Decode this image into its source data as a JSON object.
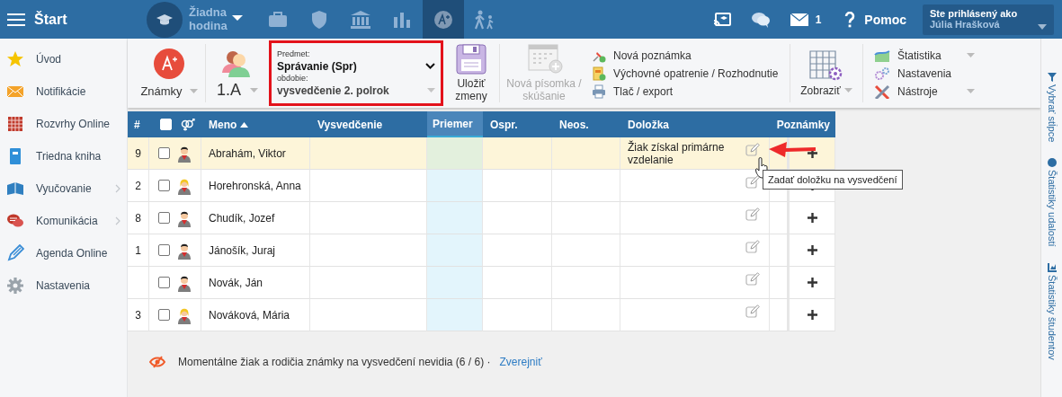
{
  "topbar": {
    "menu_label": "Štart",
    "lesson": "Žiadna hodina",
    "nav": [
      {
        "kind": "briefcase",
        "selected": false
      },
      {
        "kind": "shield",
        "selected": false
      },
      {
        "kind": "bank",
        "selected": false
      },
      {
        "kind": "chart",
        "selected": false
      },
      {
        "kind": "grade",
        "selected": true
      },
      {
        "kind": "walk",
        "selected": false
      }
    ],
    "message_count": "1",
    "help": "Pomoc",
    "user": {
      "caption": "Ste prihlásený ako",
      "name": "Júlia Hrašková"
    }
  },
  "sidebar": {
    "items": [
      {
        "label": "Úvod",
        "kind": "star",
        "has_submenu": false
      },
      {
        "label": "Notifikácie",
        "kind": "mail",
        "has_submenu": false
      },
      {
        "label": "Rozvrhy Online",
        "kind": "calendar",
        "has_submenu": false
      },
      {
        "label": "Triedna kniha",
        "kind": "book",
        "has_submenu": false
      },
      {
        "label": "Vyučovanie",
        "kind": "openbook",
        "has_submenu": true
      },
      {
        "label": "Komunikácia",
        "kind": "chat",
        "has_submenu": true
      },
      {
        "label": "Agenda Online",
        "kind": "pen",
        "has_submenu": false
      },
      {
        "label": "Nastavenia",
        "kind": "gear",
        "has_submenu": false
      }
    ]
  },
  "toolbar": {
    "grades": "Známky",
    "class": "1.A",
    "subject": {
      "label": "Predmet:",
      "value": "Správanie (Spr)"
    },
    "period": {
      "label": "obdobie:",
      "value": "vysvedčenie 2. polrok"
    },
    "save": "Uložiť zmeny",
    "new_test": {
      "label": "Nová písomka / skúšanie",
      "disabled": true
    },
    "actions": [
      {
        "label": "Nová poznámka",
        "kind": "pin"
      },
      {
        "label": "Výchovné opatrenie / Rozhodnutie",
        "kind": "document"
      },
      {
        "label": "Tlač / export",
        "kind": "printer"
      }
    ],
    "view": "Zobraziť",
    "menus": [
      {
        "label": "Štatistika",
        "kind": "area",
        "has_dropdown": true
      },
      {
        "label": "Nastavenia",
        "kind": "gears",
        "has_dropdown": false
      },
      {
        "label": "Nástroje",
        "kind": "tools",
        "has_dropdown": true
      }
    ]
  },
  "table": {
    "columns": [
      {
        "label": "#",
        "highlighted": false,
        "sorted": false
      },
      {
        "label": "Meno",
        "highlighted": false,
        "sorted": true
      },
      {
        "label": "Vysvedčenie",
        "highlighted": false,
        "sorted": false
      },
      {
        "label": "Priemer",
        "highlighted": true,
        "sorted": false
      },
      {
        "label": "Ospr.",
        "highlighted": false,
        "sorted": false
      },
      {
        "label": "Neos.",
        "highlighted": false,
        "sorted": false
      },
      {
        "label": "Doložka",
        "highlighted": false,
        "sorted": false
      },
      {
        "label": "Poznámky",
        "highlighted": false,
        "sorted": false
      }
    ],
    "all_checked": false,
    "rows": [
      {
        "number": "9",
        "name": "Abrahám, Viktor",
        "kind": "boy",
        "checked": false,
        "selected": true,
        "clause": "Žiak získal primárne vzdelanie"
      },
      {
        "number": "2",
        "name": "Horehronská, Anna",
        "kind": "girl",
        "checked": false,
        "selected": false
      },
      {
        "number": "8",
        "name": "Chudík, Jozef",
        "kind": "boy",
        "checked": false,
        "selected": false
      },
      {
        "number": "1",
        "name": "Jánošík, Juraj",
        "kind": "boy",
        "checked": false,
        "selected": false
      },
      {
        "name": "Novák, Ján",
        "kind": "boy",
        "checked": false,
        "selected": false
      },
      {
        "number": "3",
        "name": "Nováková, Mária",
        "kind": "girl",
        "checked": false,
        "selected": false
      }
    ],
    "tooltip": "Zadať doložku na vysvedčení"
  },
  "notice": {
    "text": "Momentálne žiak a rodičia známky na vysvedčení nevidia (6 / 6) ·",
    "link": "Zverejniť"
  },
  "side_strip": [
    "Vybrať stĺpce",
    "Štatistiky udalostí",
    "Štatistiky študentov"
  ]
}
